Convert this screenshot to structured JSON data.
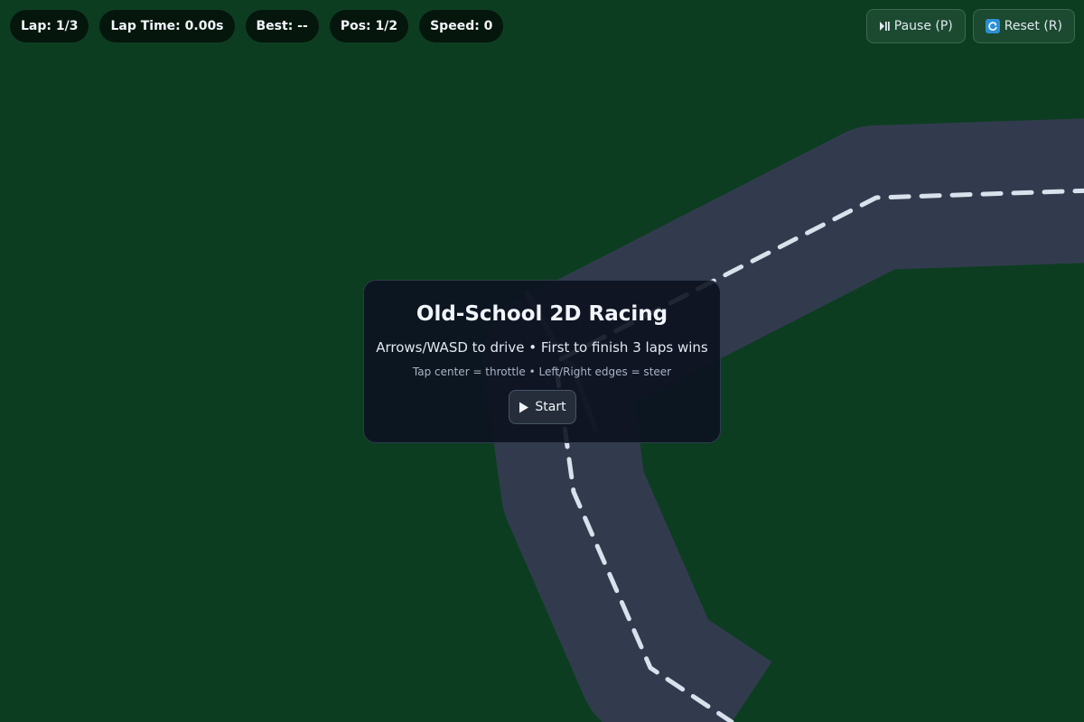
{
  "hud": {
    "lap": "Lap: 1/3",
    "lap_time": "Lap Time: 0.00s",
    "best": "Best: --",
    "position": "Pos: 1/2",
    "speed": "Speed: 0"
  },
  "controls": {
    "pause_label": "Pause (P)",
    "pause_icon": "play-pause-icon",
    "reset_label": "Reset (R)",
    "reset_icon": "reset-icon"
  },
  "overlay": {
    "title": "Old-School 2D Racing",
    "subtitle": "Arrows/WASD to drive • First to finish 3 laps wins",
    "hint": "Tap center = throttle • Left/Right edges = steer",
    "start_label": "Start",
    "start_icon": "play-icon"
  },
  "colors": {
    "grass": "#0d3d21",
    "track": "#323b4e",
    "center_line": "#d9e1ec",
    "hud_pill": "#05160c"
  }
}
